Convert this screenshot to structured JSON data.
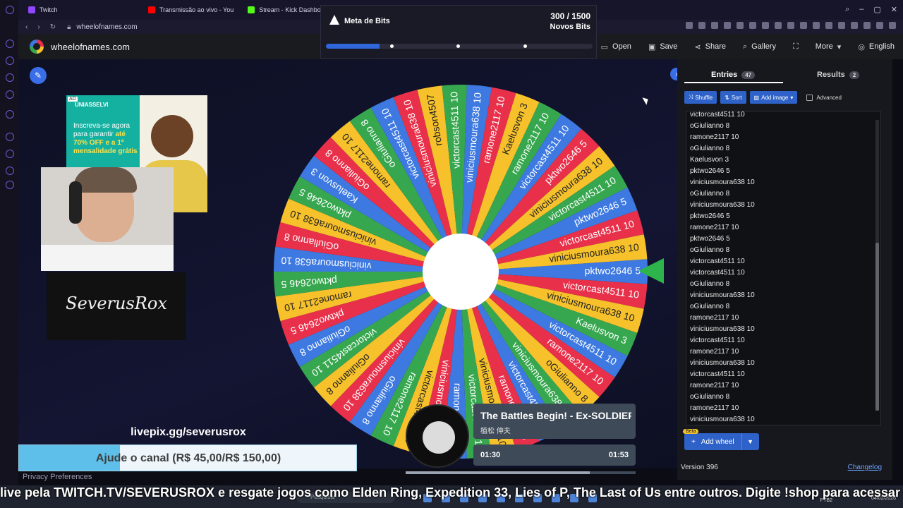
{
  "browser": {
    "tabs": [
      {
        "label": "Twitch",
        "color": "#9146ff"
      },
      {
        "label": "Transmissão ao vivo - You",
        "color": "#ff0000"
      },
      {
        "label": "Stream - Kick Dashboard",
        "color": "#53fc18"
      }
    ],
    "url": "wheelofnames.com"
  },
  "site": {
    "title": "wheelofnames.com",
    "menu": [
      {
        "icon": "folder-open-icon",
        "label": "Open"
      },
      {
        "icon": "save-icon",
        "label": "Save"
      },
      {
        "icon": "share-icon",
        "label": "Share"
      },
      {
        "icon": "search-icon",
        "label": "Gallery"
      },
      {
        "icon": "fullscreen-icon",
        "label": ""
      },
      {
        "icon": "chevron-down-icon",
        "label": "More"
      },
      {
        "icon": "globe-icon",
        "label": "English"
      }
    ]
  },
  "bits": {
    "title": "Meta de Bits",
    "count": "300 / 1500",
    "subtitle": "Novos Bits",
    "progress": 0.2
  },
  "ad": {
    "badge": "AD",
    "brand": "UNIASSELVI",
    "line1": "Inscreva-se agora para garantir",
    "highlight": "até 70% OFF e a 1ª mensalidade grátis"
  },
  "overlay": {
    "streamer_logo": "SeverusRox",
    "livepix": "livepix.gg/severusrox",
    "goal_text": "Ajude o canal (R$ 45,00/R$ 150,00)",
    "goal_progress": 0.3
  },
  "wheel": {
    "colors": [
      "#3d79e0",
      "#e8304a",
      "#f6c12b",
      "#37a74f"
    ],
    "pointer_color": "#2db44a",
    "segments": [
      "pktwo2646 5",
      "victorcast4511 10",
      "viniciusmoura638 10",
      "Kaelusvon 3",
      "victorcast4511 10",
      "ramone2117 10",
      "oGiulianno 8",
      "viniciusmoura638 10",
      "victorcast4511 10",
      "ramone2117 10",
      "viniciusmoura638 10",
      "victorcast4511 10",
      "ramone2117 10",
      "viniciusmoura638 10",
      "victorcast4511 10",
      "ramone2117 10",
      "oGiulianno 8",
      "viniciusmoura638 10",
      "oGiulianno 8",
      "victorcast4511 10",
      "oGiulianno 8",
      "pktwo2646 5",
      "ramone2117 10",
      "pktwo2646 5",
      "viniciusmoura638 10",
      "oGiulianno 8",
      "viniciusmoura638 10",
      "pktwo2646 5",
      "Kaelusvon 3",
      "oGiulianno 8",
      "ramone2117 10",
      "oGiulianno 8",
      "victorcast4511 10",
      "viniciusmoura638 10",
      "robson4507",
      "victorcast4511 10",
      "viniciusmoura638 10",
      "ramone2117 10",
      "Kaelusvon 3",
      "ramone2117 10",
      "victorcast4511 10",
      "pktwo2646 5",
      "viniciusmoura638 10",
      "victorcast4511 10",
      "pktwo2646 5",
      "victorcast4511 10",
      "viniciusmoura638 10"
    ]
  },
  "music": {
    "title": "The Battles Begin! - Ex-SOLDIER",
    "artist": "植松 伸夫",
    "elapsed": "01:30",
    "duration": "01:53",
    "progress": 0.8
  },
  "panel": {
    "tabs": [
      {
        "label": "Entries",
        "count": "47"
      },
      {
        "label": "Results",
        "count": "2"
      }
    ],
    "tools": [
      {
        "icon": "shuffle-icon",
        "label": "Shuffle"
      },
      {
        "icon": "sort-icon",
        "label": "Sort"
      },
      {
        "icon": "image-icon",
        "label": "Add image"
      }
    ],
    "advanced_label": "Advanced",
    "entries": [
      "victorcast4511 10",
      "oGiulianno 8",
      "ramone2117 10",
      "oGiulianno 8",
      "Kaelusvon 3",
      "pktwo2646 5",
      "viniciusmoura638 10",
      "oGiulianno 8",
      "viniciusmoura638 10",
      "pktwo2646 5",
      "ramone2117 10",
      "pktwo2646 5",
      "oGiulianno 8",
      "victorcast4511 10",
      "victorcast4511 10",
      "oGiulianno 8",
      "viniciusmoura638 10",
      "oGiulianno 8",
      "ramone2117 10",
      "viniciusmoura638 10",
      "victorcast4511 10",
      "ramone2117 10",
      "viniciusmoura638 10",
      "victorcast4511 10",
      "ramone2117 10",
      "oGiulianno 8",
      "ramone2117 10",
      "viniciusmoura638 10"
    ],
    "beta": "Beta",
    "add_wheel": "Add wheel",
    "version": "Version 396",
    "changelog": "Changelog"
  },
  "footer": {
    "privacy": "Privacy Preferences",
    "ticker": "live pela TWITCH.TV/SEVERUSROX e resgate jogos como Elden Ring, Expedition 33, Lies of P, The Last of Us entre outros. Digite !shop para acessar a loja e",
    "search_placeholder": "Pesquisar",
    "lang": "PTB2",
    "date": "04/02/2026"
  }
}
